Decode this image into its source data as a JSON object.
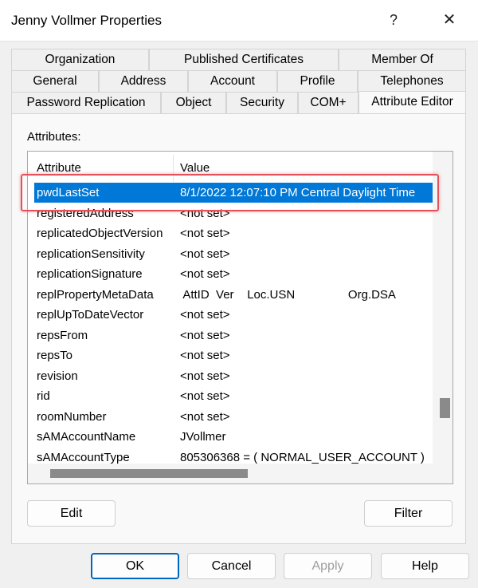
{
  "window": {
    "title": "Jenny Vollmer Properties",
    "help_glyph": "?",
    "close_glyph": "✕"
  },
  "tabs": {
    "row1": [
      "Organization",
      "Published Certificates",
      "Member Of"
    ],
    "row2": [
      "General",
      "Address",
      "Account",
      "Profile",
      "Telephones"
    ],
    "row3": [
      "Password Replication",
      "Object",
      "Security",
      "COM+",
      "Attribute Editor"
    ],
    "active": "Attribute Editor"
  },
  "attributes": {
    "label": "Attributes:",
    "col_attribute": "Attribute",
    "col_value": "Value",
    "rows": [
      {
        "attr": "pwdLastSet",
        "value": "8/1/2022 12:07:10 PM Central Daylight Time"
      },
      {
        "attr": "registeredAddress",
        "value": "<not set>"
      },
      {
        "attr": "replicatedObjectVersion",
        "value": "<not set>"
      },
      {
        "attr": "replicationSensitivity",
        "value": "<not set>"
      },
      {
        "attr": "replicationSignature",
        "value": "<not set>"
      },
      {
        "attr": "replPropertyMetaData",
        "value": " AttID  Ver    Loc.USN                Org.DSA"
      },
      {
        "attr": "replUpToDateVector",
        "value": "<not set>"
      },
      {
        "attr": "repsFrom",
        "value": "<not set>"
      },
      {
        "attr": "repsTo",
        "value": "<not set>"
      },
      {
        "attr": "revision",
        "value": "<not set>"
      },
      {
        "attr": "rid",
        "value": "<not set>"
      },
      {
        "attr": "roomNumber",
        "value": "<not set>"
      },
      {
        "attr": "sAMAccountName",
        "value": "JVollmer"
      },
      {
        "attr": "sAMAccountType",
        "value": "805306368 = ( NORMAL_USER_ACCOUNT )"
      }
    ],
    "selected_index": 0
  },
  "buttons": {
    "edit": "Edit",
    "filter": "Filter",
    "ok": "OK",
    "cancel": "Cancel",
    "apply": "Apply",
    "help": "Help"
  },
  "colors": {
    "selection": "#0078d7",
    "highlight_box": "#e3525a",
    "ok_border": "#0067c0"
  }
}
